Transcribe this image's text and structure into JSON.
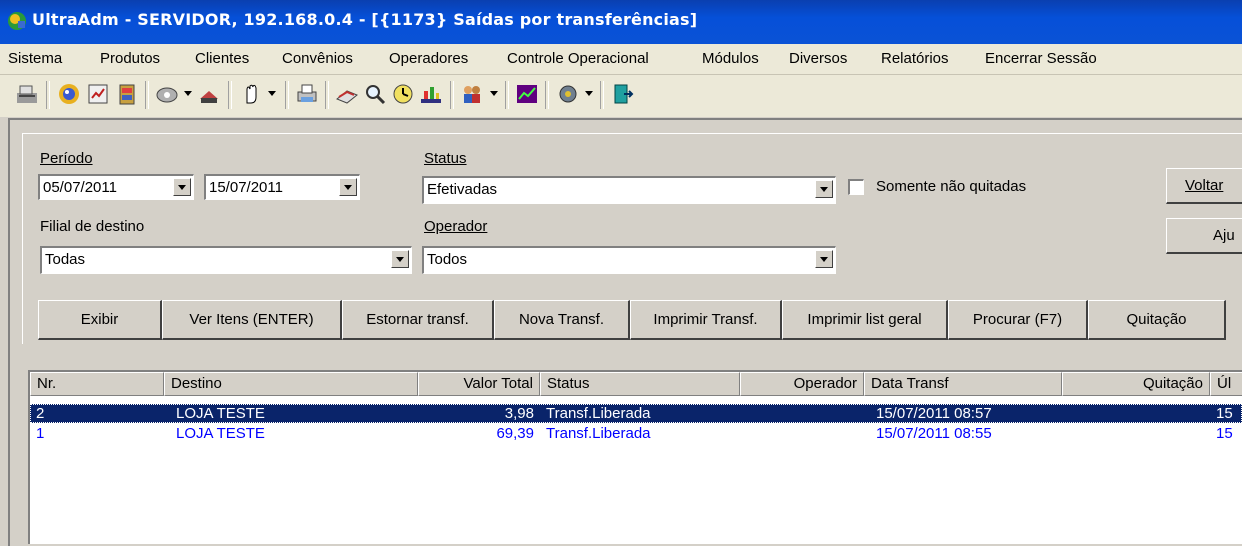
{
  "window": {
    "title": "UltraAdm - SERVIDOR, 192.168.0.4 - [{1173} Saídas por transferências]"
  },
  "menu": [
    "Sistema",
    "Produtos",
    "Clientes",
    "Convênios",
    "Operadores",
    "Controle Operacional",
    "Módulos",
    "Diversos",
    "Relatórios",
    "Encerrar Sessão"
  ],
  "filters": {
    "periodo_label": "Período",
    "date_from": "05/07/2011",
    "date_to": "15/07/2011",
    "status_label": "Status",
    "status_value": "Efetivadas",
    "somente_label": "Somente não quitadas",
    "filial_label": "Filial de destino",
    "filial_value": "Todas",
    "operador_label": "Operador",
    "operador_value": "Todos"
  },
  "side_buttons": {
    "voltar": "Voltar",
    "ajuda": "Aju"
  },
  "actions": [
    "Exibir",
    "Ver Itens (ENTER)",
    "Estornar transf.",
    "Nova Transf.",
    "Imprimir Transf.",
    "Imprimir list geral",
    "Procurar (F7)",
    "Quitação"
  ],
  "table": {
    "columns": [
      "Nr.",
      "Destino",
      "Valor Total",
      "Status",
      "Operador",
      "Data Transf",
      "Quitação",
      "Úl"
    ],
    "rows": [
      {
        "nr": "2",
        "destino": "LOJA TESTE",
        "valor": "3,98",
        "status": "Transf.Liberada",
        "operador": "",
        "data": "15/07/2011 08:57",
        "quitacao": "",
        "ult": "15",
        "selected": true
      },
      {
        "nr": "1",
        "destino": "LOJA TESTE",
        "valor": "69,39",
        "status": "Transf.Liberada",
        "operador": "",
        "data": "15/07/2011 08:55",
        "quitacao": "",
        "ult": "15",
        "selected": false
      }
    ]
  },
  "colors": {
    "titlebar": "#0a52d6",
    "selection": "#0a246a",
    "row_text": "#0000ff"
  },
  "toolbar_icons": [
    "cash-register-icon",
    "globe-icon",
    "report-icon",
    "cabinet-icon",
    "tape-icon",
    "dropdown-icon",
    "box-icon",
    "hand-icon",
    "dropdown-icon",
    "printer-icon",
    "books-icon",
    "search-icon",
    "clock-icon",
    "chart-icon",
    "people-icon",
    "dropdown-icon",
    "graph-icon",
    "gear-icon",
    "dropdown-icon",
    "exit-icon"
  ]
}
